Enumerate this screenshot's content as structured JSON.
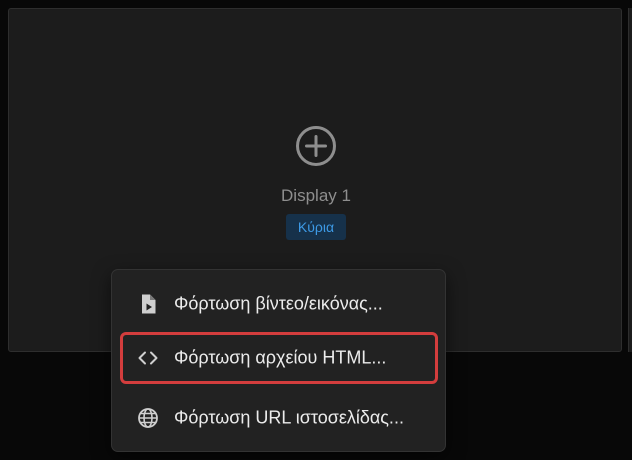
{
  "display": {
    "label": "Display 1",
    "badge": "Κύρια",
    "add_icon": "plus-circle-icon"
  },
  "menu": {
    "items": [
      {
        "label": "Φόρτωση βίντεο/εικόνας...",
        "icon": "file-media-icon",
        "highlighted": false
      },
      {
        "label": "Φόρτωση αρχείου HTML...",
        "icon": "code-icon",
        "highlighted": true
      },
      {
        "label": "Φόρτωση URL ιστοσελίδας...",
        "icon": "globe-icon",
        "highlighted": false
      }
    ]
  },
  "colors": {
    "background": "#080808",
    "panel": "#1c1c1c",
    "menu": "#222222",
    "badge_bg": "#16314a",
    "badge_text": "#3d9ae6",
    "highlight_border": "#d33d3d"
  }
}
